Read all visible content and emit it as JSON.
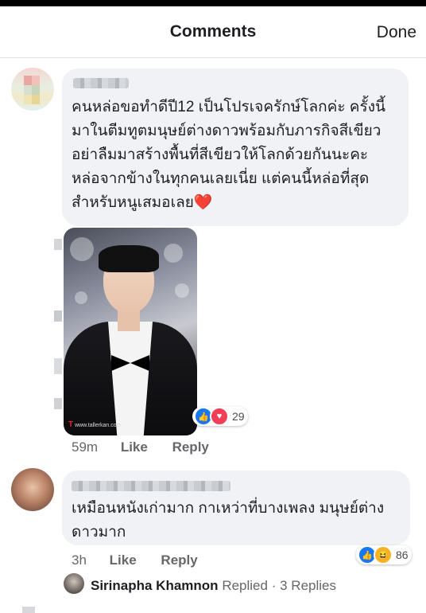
{
  "header": {
    "title": "Comments",
    "done_label": "Done"
  },
  "comments": [
    {
      "text": "คนหล่อขอทำดีปี12 เป็นโปรเจครักษ์โลกค่ะ ครั้งนี้\nมาในตีมทูตมนุษย์ต่างดาวพร้อมกับภารกิจสีเขียว\nอย่าลืมมาสร้างพื้นที่สีเขียวให้โลกด้วยกันนะคะ\nหล่อจากข้างในทุกคนเลยเนี่ย แต่คนนี้หล่อที่สุด\nสำหรับหนูเสมอเลย",
      "emoji": "❤️",
      "time": "59m",
      "like_label": "Like",
      "reply_label": "Reply",
      "reaction_count": "29",
      "photo_watermark": "www.tallerkan.com"
    },
    {
      "text": "เหมือนหนังเก่ามาก กาเหว่าที่บางเพลง มนุษย์ต่าง\nดาวมาก",
      "time": "3h",
      "like_label": "Like",
      "reply_label": "Reply",
      "reaction_count": "86",
      "replies": {
        "name": "Sirinapha Khamnon",
        "action": "Replied",
        "separator": "·",
        "count_label": "3 Replies"
      }
    }
  ],
  "icons": {
    "like": "thumbs-up-icon",
    "love": "heart-icon",
    "haha": "laughing-face-icon"
  },
  "colors": {
    "like": "#1877f2",
    "love": "#f33e58",
    "haha": "#f7b125",
    "bubble": "#f0f2f5",
    "secondary_text": "#65676b"
  }
}
